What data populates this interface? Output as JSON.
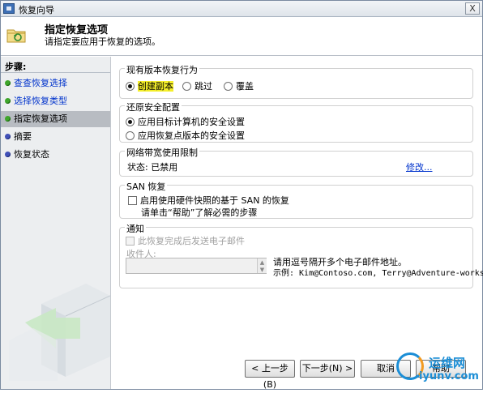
{
  "window": {
    "title": "恢复向导",
    "close_glyph": "X"
  },
  "header": {
    "title": "指定恢复选项",
    "subtitle": "请指定要应用于恢复的选项。"
  },
  "sidebar": {
    "title": "步骤:",
    "steps": [
      {
        "label": "查查恢复选择",
        "state": "done"
      },
      {
        "label": "选择恢复类型",
        "state": "done"
      },
      {
        "label": "指定恢复选项",
        "state": "current"
      },
      {
        "label": "摘要",
        "state": "todo"
      },
      {
        "label": "恢复状态",
        "state": "todo"
      }
    ]
  },
  "existing_version": {
    "legend": "现有版本恢复行为",
    "options": [
      "创建副本",
      "跳过",
      "覆盖"
    ],
    "selected": "创建副本"
  },
  "security": {
    "legend": "还原安全配置",
    "options": [
      "应用目标计算机的安全设置",
      "应用恢复点版本的安全设置"
    ],
    "selected": "应用目标计算机的安全设置"
  },
  "bandwidth": {
    "legend": "网络带宽使用限制",
    "status": "状态: 已禁用",
    "modify_link": "修改..."
  },
  "san": {
    "legend": "SAN 恢复",
    "checkbox_label": "启用使用硬件快照的基于 SAN 的恢复",
    "hint": "请单击“帮助”了解必需的步骤",
    "checked": false
  },
  "notify": {
    "legend": "通知",
    "checkbox_label": "此恢复完成后发送电子邮件",
    "recipients_label": "收件人:",
    "recipients_value": "",
    "help_line1": "请用逗号隔开多个电子邮件地址。",
    "help_line2": "示例: Kim@Contoso.com, Terry@Adventure-works.com"
  },
  "buttons": {
    "back": "< 上一步(B)",
    "next": "下一步(N) >",
    "cancel": "取消",
    "help": "帮助"
  },
  "watermark": {
    "cn": "运维网",
    "en": "iyunv.com"
  },
  "colors": {
    "accent_link": "#0033cc",
    "done_dot": "#3fa62b",
    "todo_dot": "#4050b8",
    "current_step_bg": "#b8bcc2",
    "highlight": "#f5ef2a"
  }
}
